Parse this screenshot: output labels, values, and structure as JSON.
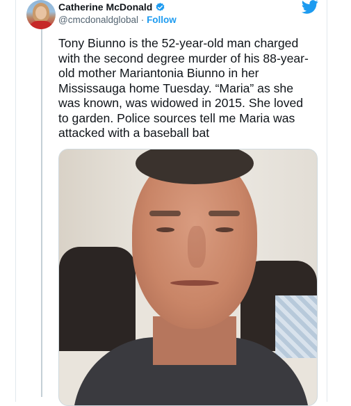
{
  "author": {
    "name": "Catherine McDonald",
    "handle": "@cmcdonaldglobal",
    "separator": "·",
    "follow_label": "Follow",
    "verified_icon": "verified-badge-icon"
  },
  "platform_icon": "twitter-bird-icon",
  "tweet": {
    "text": "Tony Biunno is the 52-year-old man charged\nwith the second degree murder of his 88-year-\nold mother Mariantonia Biunno in her\nMississauga home Tuesday. “Maria” as she\nwas known, was widowed in 2015. She loved\nto garden. Police sources tell me Maria was\nattacked with a baseball bat"
  },
  "colors": {
    "accent": "#1d9bf0",
    "text": "#0f1419",
    "secondary_text": "#536471",
    "border": "#e1e8ed"
  }
}
